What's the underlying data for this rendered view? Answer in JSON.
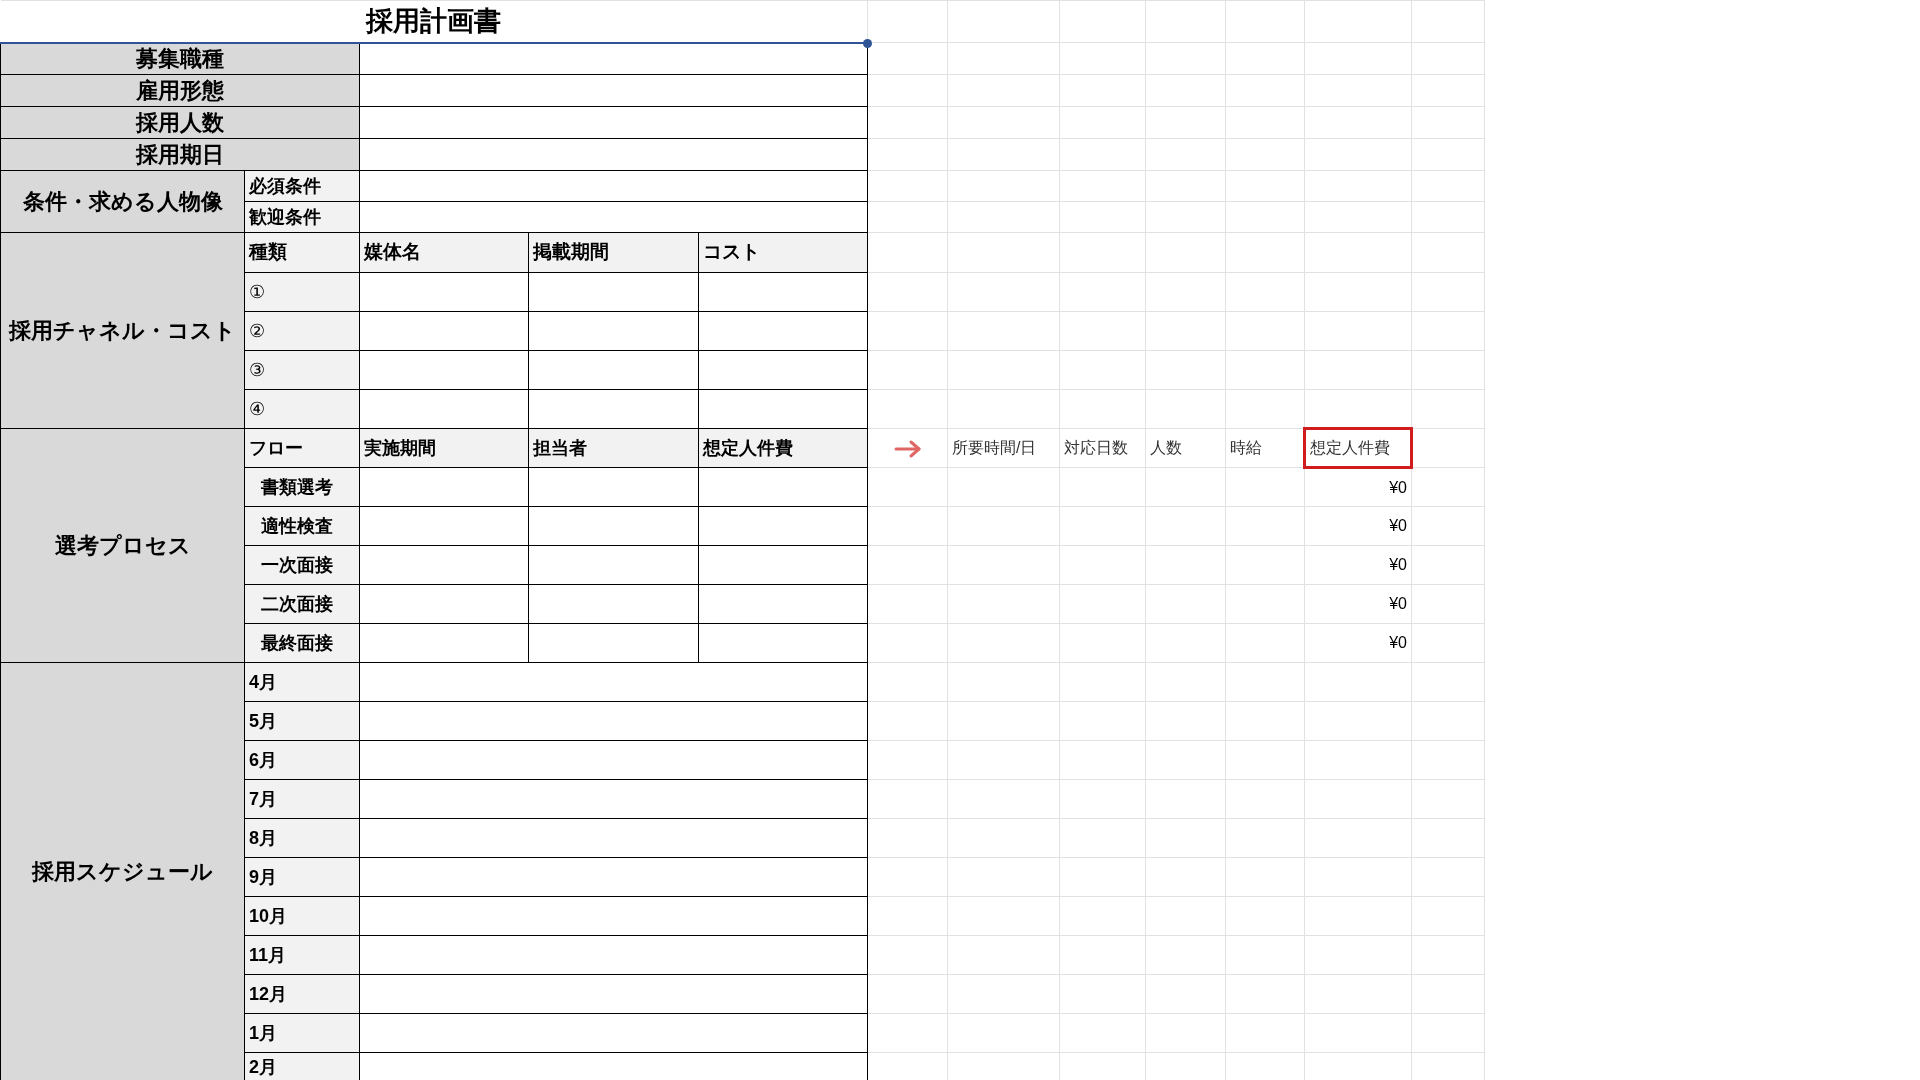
{
  "title": {
    "text": "採用計画書",
    "selected": true
  },
  "basic_fields": [
    "募集職種",
    "雇用形態",
    "採用人数",
    "採用期日"
  ],
  "conditions": {
    "label": "条件・求める人物像",
    "items": [
      "必須条件",
      "歓迎条件"
    ]
  },
  "channels": {
    "label": "採用チャネル・コスト",
    "columns": [
      "種類",
      "媒体名",
      "掲載期間",
      "コスト"
    ],
    "rows": [
      "①",
      "②",
      "③",
      "④"
    ]
  },
  "selection": {
    "label": "選考プロセス",
    "columns": [
      "フロー",
      "実施期間",
      "担当者",
      "想定人件費"
    ],
    "calc_columns": [
      {
        "label": "所要時間/日",
        "highlighted": false
      },
      {
        "label": "対応日数",
        "highlighted": false
      },
      {
        "label": "人数",
        "highlighted": false
      },
      {
        "label": "時給",
        "highlighted": false
      },
      {
        "label": "想定人件費",
        "highlighted": true
      }
    ],
    "steps": [
      {
        "name": "書類選考",
        "cost": "¥0"
      },
      {
        "name": "適性検査",
        "cost": "¥0"
      },
      {
        "name": "一次面接",
        "cost": "¥0"
      },
      {
        "name": "二次面接",
        "cost": "¥0"
      },
      {
        "name": "最終面接",
        "cost": "¥0"
      }
    ]
  },
  "schedule": {
    "label": "採用スケジュール",
    "months": [
      "4月",
      "5月",
      "6月",
      "7月",
      "8月",
      "9月",
      "10月",
      "11月",
      "12月",
      "1月",
      "2月"
    ]
  }
}
